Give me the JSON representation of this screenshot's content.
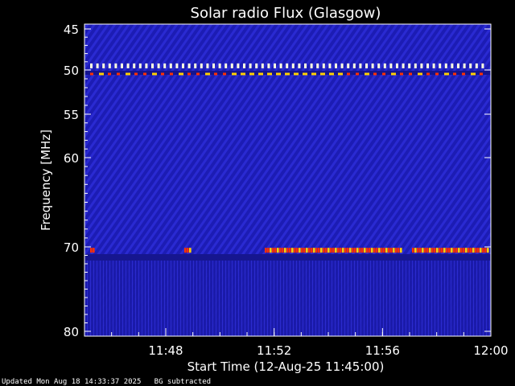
{
  "chart_data": {
    "type": "heatmap",
    "title": "Solar radio Flux (Glasgow)",
    "xlabel": "Start Time (12-Aug-25 11:45:00)",
    "ylabel": "Frequency [MHz]",
    "x_range_minutes": [
      "11:45",
      "12:00"
    ],
    "y_range_mhz": [
      45,
      80
    ],
    "x_ticks": [
      "11:48",
      "11:52",
      "11:56",
      "12:00"
    ],
    "y_ticks": [
      "45",
      "50",
      "55",
      "60",
      "70",
      "80"
    ],
    "y_tick_values": [
      45,
      50,
      55,
      60,
      70,
      80
    ],
    "x_tick_values": [
      "11:48",
      "11:52",
      "11:56",
      "12:00"
    ],
    "interference_bands_mhz": [
      49.5,
      50.5,
      70.4
    ],
    "background": "BG subtracted",
    "colors": {
      "background": "#1a1ab0",
      "band_hot": "#ffd000",
      "band_warm": "#ff3000",
      "band_white": "#ffffe0"
    }
  },
  "footer": {
    "updated": "Updated Mon Aug 18 14:33:37 2025",
    "note": "BG subtracted"
  }
}
